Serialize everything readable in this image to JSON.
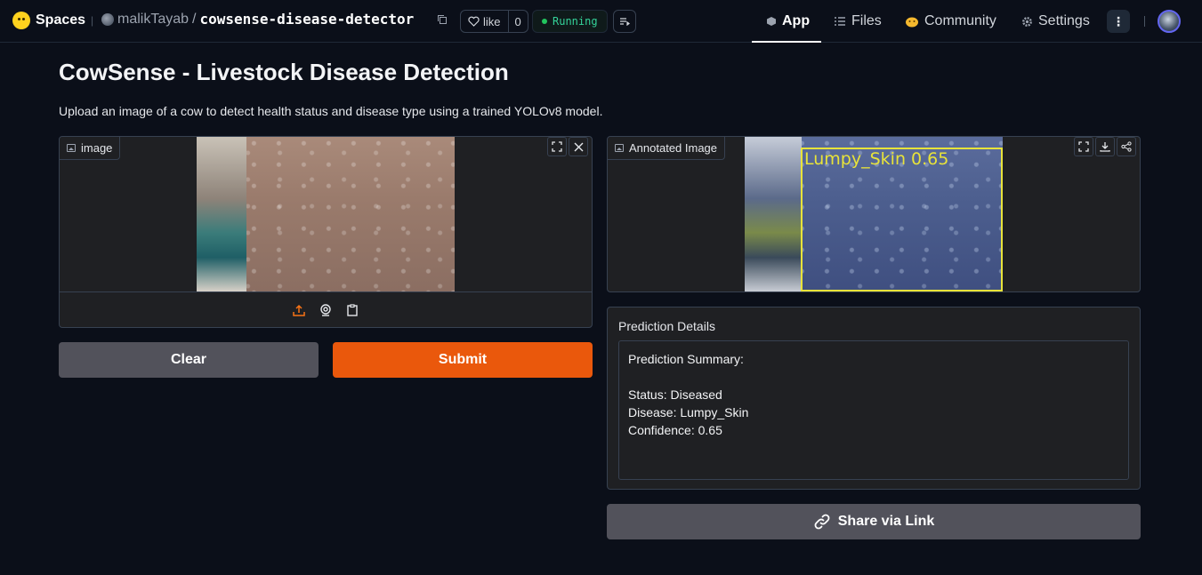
{
  "topbar": {
    "brand": "Spaces",
    "owner": "malikTayab",
    "separator": "/",
    "space_name": "cowsense-disease-detector",
    "like_label": "like",
    "like_count": "0",
    "status": "Running",
    "status_color": "#22c55e",
    "nav": {
      "app": "App",
      "files": "Files",
      "community": "Community",
      "settings": "Settings"
    },
    "icons": {
      "brand": "hugging-face-icon",
      "copy": "copy-icon",
      "like": "heart-icon",
      "logs": "logs-icon",
      "app": "cube-icon",
      "files": "files-icon",
      "community": "community-icon",
      "settings": "gear-icon",
      "more": "kebab-icon"
    }
  },
  "main": {
    "title": "CowSense - Livestock Disease Detection",
    "description": "Upload an image of a cow to detect health status and disease type using a trained YOLOv8 model.",
    "input_panel": {
      "label": "image",
      "source_icons": [
        "upload-icon",
        "webcam-icon",
        "clipboard-icon"
      ]
    },
    "output_panel": {
      "label": "Annotated Image",
      "detection_label": "Lumpy_Skin  0.65",
      "detection_color": "#e8e33a"
    },
    "buttons": {
      "clear": "Clear",
      "submit": "Submit",
      "share": "Share via Link"
    },
    "accent_color": "#ea580c",
    "details": {
      "label": "Prediction Details",
      "text": "Prediction Summary:\n\nStatus: Diseased\nDisease: Lumpy_Skin\nConfidence: 0.65"
    }
  }
}
